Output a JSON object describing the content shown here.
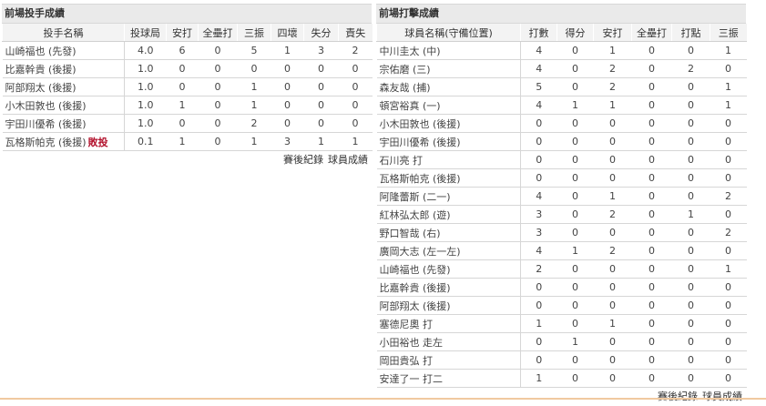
{
  "pitching": {
    "title": "前場投手成績",
    "headers": [
      "投手名稱",
      "投球局",
      "安打",
      "全壘打",
      "三振",
      "四壞",
      "失分",
      "責失"
    ],
    "rows": [
      {
        "name": "山崎福也 (先發)",
        "suffix": "",
        "stats": [
          "4.0",
          "6",
          "0",
          "5",
          "1",
          "3",
          "2"
        ]
      },
      {
        "name": "比嘉幹貴 (後援)",
        "suffix": "",
        "stats": [
          "1.0",
          "0",
          "0",
          "0",
          "0",
          "0",
          "0"
        ]
      },
      {
        "name": "阿部翔太 (後援)",
        "suffix": "",
        "stats": [
          "1.0",
          "0",
          "0",
          "1",
          "0",
          "0",
          "0"
        ]
      },
      {
        "name": "小木田敦也 (後援)",
        "suffix": "",
        "stats": [
          "1.0",
          "1",
          "0",
          "1",
          "0",
          "0",
          "0"
        ]
      },
      {
        "name": "宇田川優希 (後援)",
        "suffix": "",
        "stats": [
          "1.0",
          "0",
          "0",
          "2",
          "0",
          "0",
          "0"
        ]
      },
      {
        "name": "瓦格斯帕克 (後援)",
        "suffix": "敗投",
        "stats": [
          "0.1",
          "1",
          "0",
          "1",
          "3",
          "1",
          "1"
        ]
      }
    ],
    "links": [
      "賽後紀錄",
      "球員成績"
    ]
  },
  "batting": {
    "title": "前場打擊成績",
    "headers": [
      "球員名稱(守備位置)",
      "打數",
      "得分",
      "安打",
      "全壘打",
      "打點",
      "三振"
    ],
    "rows": [
      {
        "name": "中川圭太 (中)",
        "stats": [
          "4",
          "0",
          "1",
          "0",
          "0",
          "1"
        ]
      },
      {
        "name": "宗佑磨 (三)",
        "stats": [
          "4",
          "0",
          "2",
          "0",
          "2",
          "0"
        ]
      },
      {
        "name": "森友哉 (捕)",
        "stats": [
          "5",
          "0",
          "2",
          "0",
          "0",
          "1"
        ]
      },
      {
        "name": "頓宮裕真 (一)",
        "stats": [
          "4",
          "1",
          "1",
          "0",
          "0",
          "1"
        ]
      },
      {
        "name": "小木田敦也 (後援)",
        "stats": [
          "0",
          "0",
          "0",
          "0",
          "0",
          "0"
        ]
      },
      {
        "name": "宇田川優希 (後援)",
        "stats": [
          "0",
          "0",
          "0",
          "0",
          "0",
          "0"
        ]
      },
      {
        "name": "石川亮 打",
        "stats": [
          "0",
          "0",
          "0",
          "0",
          "0",
          "0"
        ]
      },
      {
        "name": "瓦格斯帕克 (後援)",
        "stats": [
          "0",
          "0",
          "0",
          "0",
          "0",
          "0"
        ]
      },
      {
        "name": "阿隆蕾斯 (二一)",
        "stats": [
          "4",
          "0",
          "1",
          "0",
          "0",
          "2"
        ]
      },
      {
        "name": "紅林弘太郎 (遊)",
        "stats": [
          "3",
          "0",
          "2",
          "0",
          "1",
          "0"
        ]
      },
      {
        "name": "野口智哉 (右)",
        "stats": [
          "3",
          "0",
          "0",
          "0",
          "0",
          "2"
        ]
      },
      {
        "name": "廣岡大志 (左一左)",
        "stats": [
          "4",
          "1",
          "2",
          "0",
          "0",
          "0"
        ]
      },
      {
        "name": "山崎福也 (先發)",
        "stats": [
          "2",
          "0",
          "0",
          "0",
          "0",
          "1"
        ]
      },
      {
        "name": "比嘉幹貴 (後援)",
        "stats": [
          "0",
          "0",
          "0",
          "0",
          "0",
          "0"
        ]
      },
      {
        "name": "阿部翔太 (後援)",
        "stats": [
          "0",
          "0",
          "0",
          "0",
          "0",
          "0"
        ]
      },
      {
        "name": "塞德尼奧 打",
        "stats": [
          "1",
          "0",
          "1",
          "0",
          "0",
          "0"
        ]
      },
      {
        "name": "小田裕也 走左",
        "stats": [
          "0",
          "1",
          "0",
          "0",
          "0",
          "0"
        ]
      },
      {
        "name": "岡田貴弘 打",
        "stats": [
          "0",
          "0",
          "0",
          "0",
          "0",
          "0"
        ]
      },
      {
        "name": "安達了一 打二",
        "stats": [
          "1",
          "0",
          "0",
          "0",
          "0",
          "0"
        ]
      }
    ],
    "links": [
      "賽後紀錄",
      "球員成績"
    ]
  }
}
